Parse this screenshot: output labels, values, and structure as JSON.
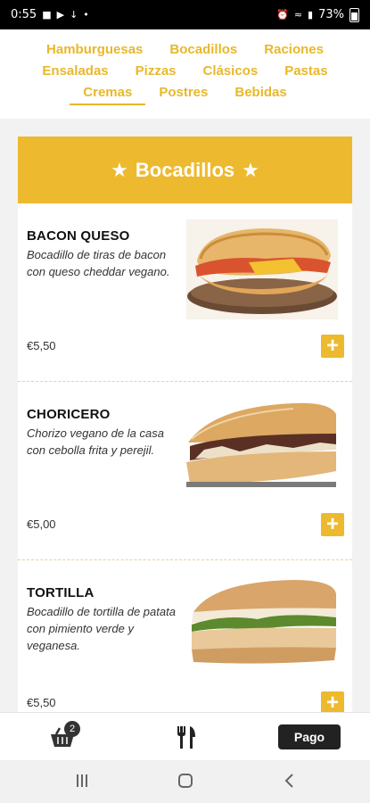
{
  "status_bar": {
    "time": "0:55",
    "battery": "73%"
  },
  "nav": {
    "row1": [
      "Hamburguesas",
      "Bocadillos",
      "Raciones"
    ],
    "row2": [
      "Ensaladas",
      "Pizzas",
      "Clásicos",
      "Pastas"
    ],
    "row3": [
      "Cremas",
      "Postres",
      "Bebidas"
    ],
    "active": "Cremas"
  },
  "section": {
    "title": "Bocadillos"
  },
  "products": [
    {
      "name": "BACON QUESO",
      "description": "Bocadillo de tiras de bacon con queso cheddar vegano.",
      "price": "€5,50"
    },
    {
      "name": "CHORICERO",
      "description": "Chorizo vegano de la casa con cebolla frita y perejil.",
      "price": "€5,00"
    },
    {
      "name": "TORTILLA",
      "description": "Bocadillo de tortilla de patata con pimiento verde y veganesa.",
      "price": "€5,50"
    }
  ],
  "bottom_bar": {
    "cart_count": "2",
    "pay_label": "Pago"
  },
  "icons": {
    "star": "star-icon",
    "add": "plus-icon",
    "cart": "basket-icon",
    "menu": "cutlery-icon"
  },
  "colors": {
    "accent": "#edb92f",
    "nav_text": "#e8b82a"
  }
}
